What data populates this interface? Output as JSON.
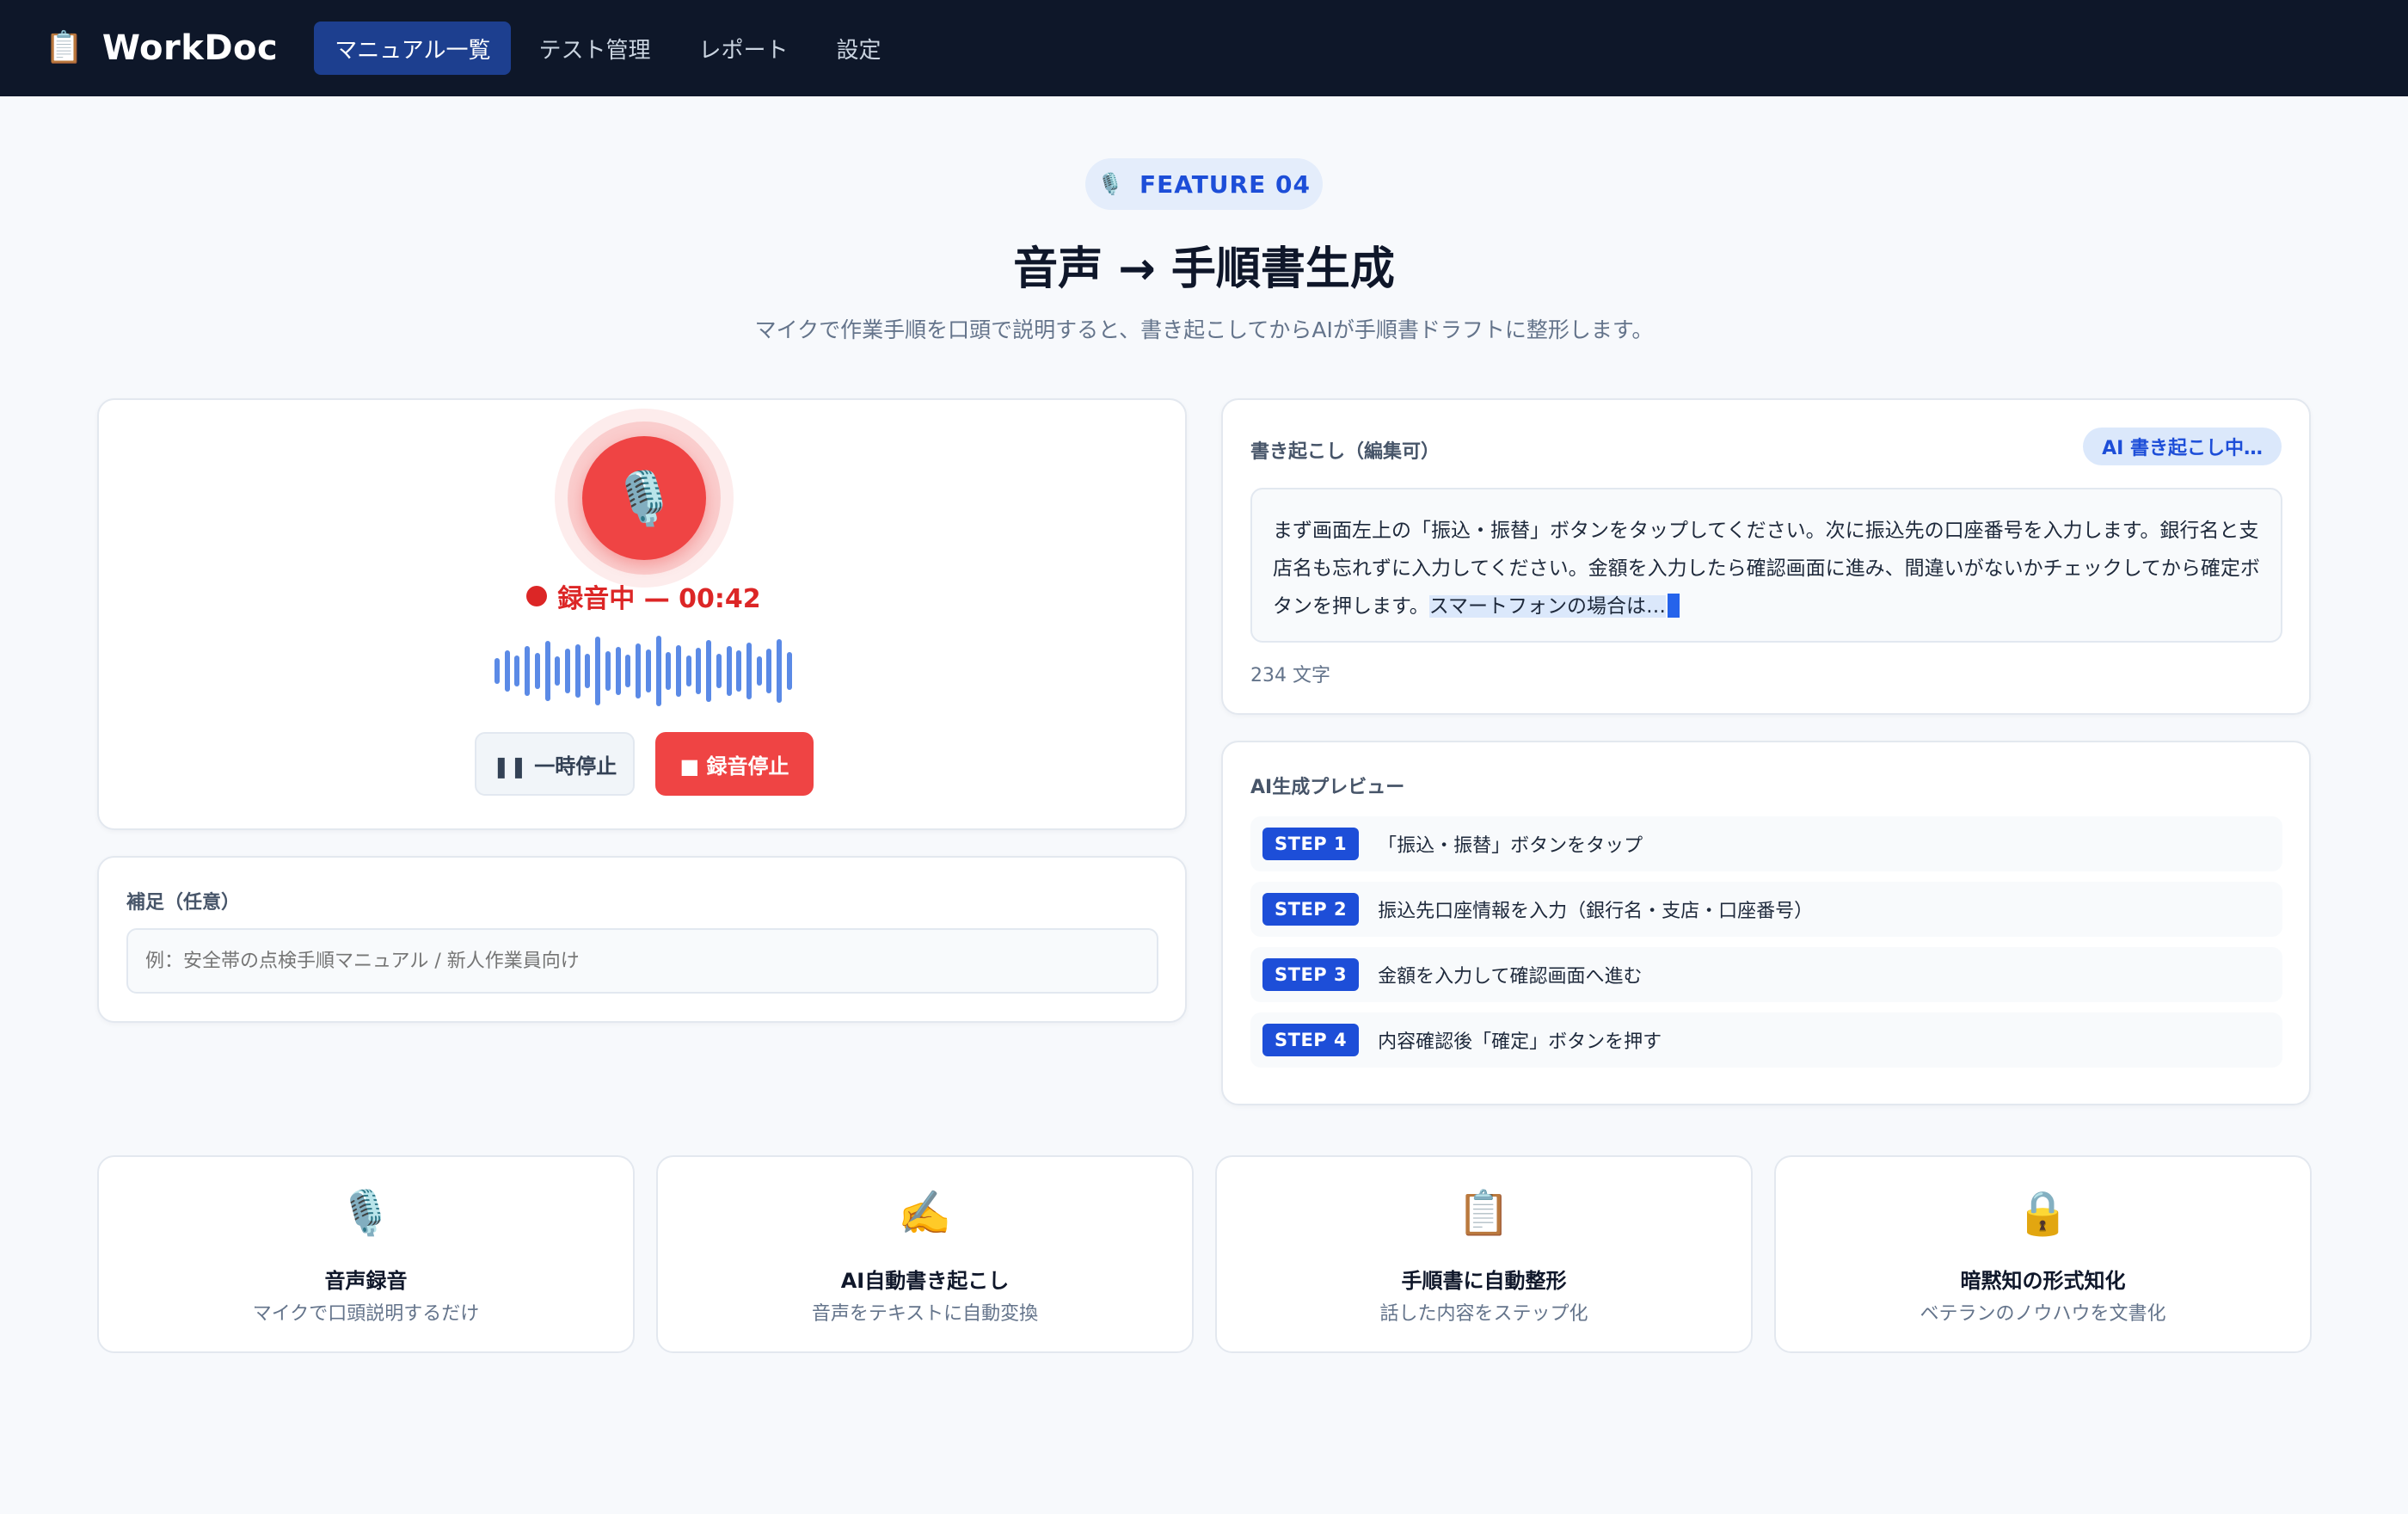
{
  "app": {
    "icon": "clipboard-icon",
    "name": "WorkDoc"
  },
  "nav": [
    {
      "label": "マニュアル一覧",
      "active": true
    },
    {
      "label": "テスト管理",
      "active": false
    },
    {
      "label": "レポート",
      "active": false
    },
    {
      "label": "設定",
      "active": false
    }
  ],
  "hero": {
    "badge": "FEATURE 04",
    "title": "音声 → 手順書生成",
    "subtitle": "マイクで作業手順を口頭で説明すると、書き起こしてからAIが手順書ドラフトに整形します。"
  },
  "recorder": {
    "status": "録音中 — 00:42",
    "pause_label": "❚❚ 一時停止",
    "stop_label": "■ 録音停止",
    "status_color": "#dc2626",
    "accent_color": "#ef4444"
  },
  "note": {
    "label": "補足（任意）",
    "placeholder": "例：安全帯の点検手順マニュアル / 新人作業員向け"
  },
  "transcript": {
    "label": "書き起こし（編集可）",
    "status_chip": "AI 書き起こし中…",
    "text": "まず画面左上の「振込・振替」ボタンをタップしてください。次に振込先の口座番号を入力します。銀行名と支店名も忘れずに入力してください。金額を入力したら確認画面に進み、間違いがないかチェックしてから確定ボタンを押します。",
    "highlighted_text": "スマートフォンの場合は…",
    "char_count": "234 文字"
  },
  "preview": {
    "label": "AI生成プレビュー",
    "steps": [
      {
        "tag": "STEP 1",
        "text": "「振込・振替」ボタンをタップ"
      },
      {
        "tag": "STEP 2",
        "text": "振込先口座情報を入力（銀行名・支店・口座番号）"
      },
      {
        "tag": "STEP 3",
        "text": "金額を入力して確認画面へ進む"
      },
      {
        "tag": "STEP 4",
        "text": "内容確認後「確定」ボタンを押す"
      }
    ]
  },
  "features": [
    {
      "icon": "microphone-icon",
      "title": "音声録音",
      "desc": "マイクで口頭説明するだけ"
    },
    {
      "icon": "writing-hand-icon",
      "title": "AI自動書き起こし",
      "desc": "音声をテキストに自動変換"
    },
    {
      "icon": "clipboard-icon",
      "title": "手順書に自動整形",
      "desc": "話した内容をステップ化"
    },
    {
      "icon": "lock-icon",
      "title": "暗黙知の形式知化",
      "desc": "ベテランのノウハウを文書化"
    }
  ],
  "colors": {
    "nav_bg": "#0e1729",
    "accent": "#1d4ed8",
    "record": "#ef4444"
  }
}
